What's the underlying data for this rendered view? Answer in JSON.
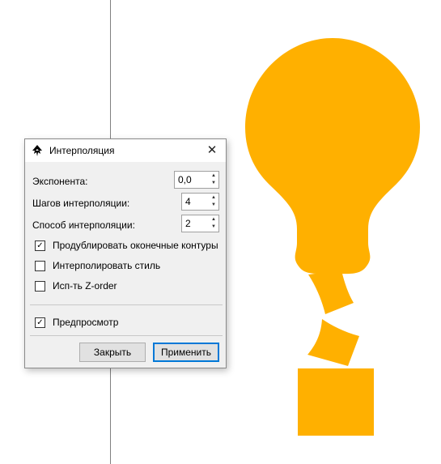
{
  "canvas": {
    "fill_color": "#ffb000",
    "guide_color": "#808080"
  },
  "dialog": {
    "title": "Интерполяция",
    "close_glyph": "✕",
    "fields": [
      {
        "label": "Экспонента:",
        "value": "0,0"
      },
      {
        "label": "Шагов интерполяции:",
        "value": "4"
      },
      {
        "label": "Способ интерполяции:",
        "value": "2"
      }
    ],
    "checkboxes": [
      {
        "label": "Продублировать оконечные контуры",
        "checked": true
      },
      {
        "label": "Интерполировать стиль",
        "checked": false
      },
      {
        "label": "Исп-ть Z-order",
        "checked": false
      }
    ],
    "preview": {
      "label": "Предпросмотр",
      "checked": true
    },
    "buttons": {
      "close": "Закрыть",
      "apply": "Применить"
    },
    "arrow_up": "▲",
    "arrow_down": "▼",
    "check_glyph": "✓"
  }
}
